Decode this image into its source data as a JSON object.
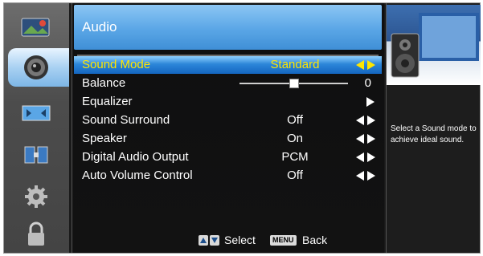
{
  "header": {
    "title": "Audio"
  },
  "sidebar": {
    "items": [
      {
        "icon": "picture-icon",
        "active": false
      },
      {
        "icon": "speaker-icon",
        "active": true
      },
      {
        "icon": "screen-icon",
        "active": false
      },
      {
        "icon": "channel-icon",
        "active": false
      },
      {
        "icon": "settings-gear-icon",
        "active": false
      },
      {
        "icon": "lock-icon",
        "active": false
      }
    ]
  },
  "menu": {
    "items": [
      {
        "label": "Sound Mode",
        "value": "Standard",
        "control": "left-right-arrows",
        "selected": true
      },
      {
        "label": "Balance",
        "value": "0",
        "control": "slider",
        "slider_level": 0.5
      },
      {
        "label": "Equalizer",
        "value": "",
        "control": "right-arrow"
      },
      {
        "label": "Sound Surround",
        "value": "Off",
        "control": "left-right-arrows"
      },
      {
        "label": "Speaker",
        "value": "On",
        "control": "left-right-arrows"
      },
      {
        "label": "Digital Audio Output",
        "value": "PCM",
        "control": "left-right-arrows"
      },
      {
        "label": "Auto Volume Control",
        "value": "Off",
        "control": "left-right-arrows"
      }
    ]
  },
  "footer": {
    "select_label": "Select",
    "menu_key": "MENU",
    "back_label": "Back"
  },
  "help": {
    "text": "Select a Sound mode to achieve ideal sound."
  },
  "colors": {
    "selected_text": "#ffe600",
    "highlight": "#2c86d9",
    "header": "#5aa6e6"
  }
}
